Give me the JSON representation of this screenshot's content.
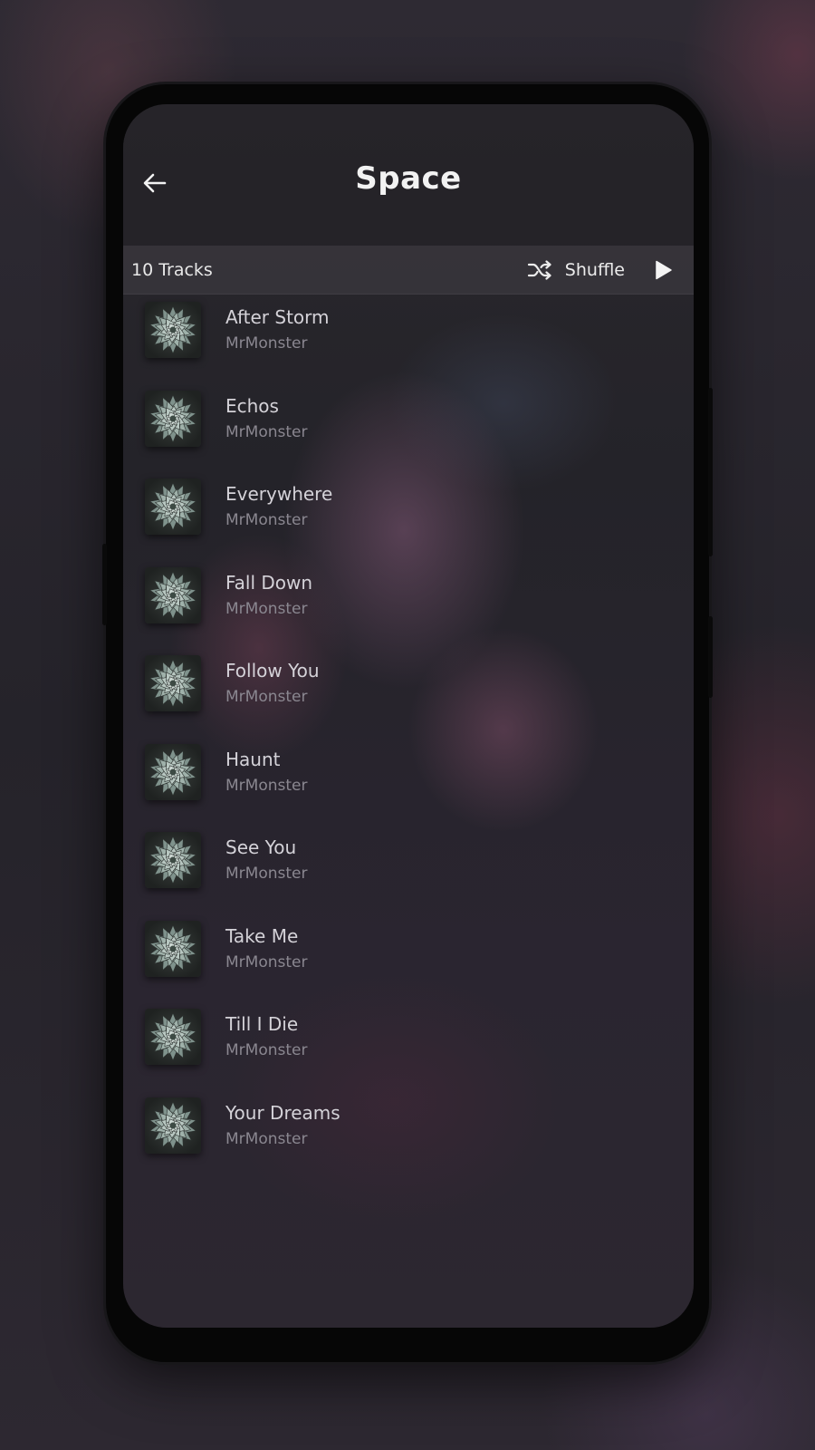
{
  "header": {
    "title": "Space"
  },
  "toolbar": {
    "track_count": "10 Tracks",
    "shuffle_label": "Shuffle"
  },
  "icons": {
    "back": "arrow-left-icon",
    "shuffle": "shuffle-icon",
    "play": "play-icon",
    "album_art": "succulent-album-art"
  },
  "tracks": [
    {
      "title": "After Storm",
      "artist": "MrMonster"
    },
    {
      "title": "Echos",
      "artist": "MrMonster"
    },
    {
      "title": "Everywhere",
      "artist": "MrMonster"
    },
    {
      "title": "Fall Down",
      "artist": "MrMonster"
    },
    {
      "title": "Follow You",
      "artist": "MrMonster"
    },
    {
      "title": "Haunt",
      "artist": "MrMonster"
    },
    {
      "title": "See You",
      "artist": "MrMonster"
    },
    {
      "title": "Take Me",
      "artist": "MrMonster"
    },
    {
      "title": "Till I Die",
      "artist": "MrMonster"
    },
    {
      "title": "Your Dreams",
      "artist": "MrMonster"
    }
  ]
}
